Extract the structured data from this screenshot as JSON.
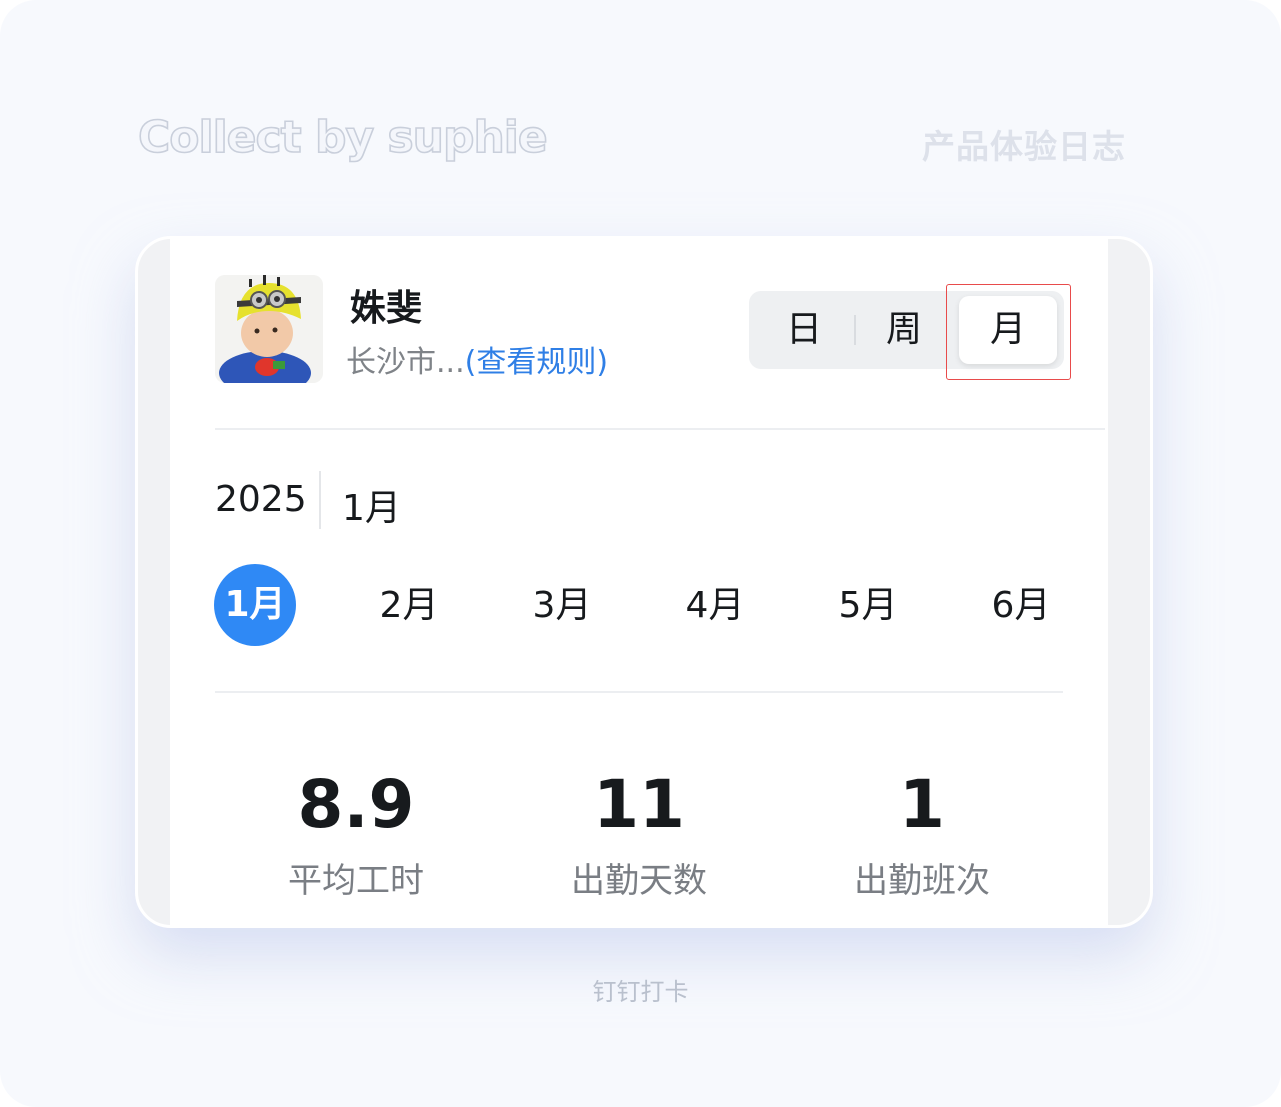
{
  "watermark": {
    "left": "Collect by suphie",
    "right": "产品体验日志"
  },
  "caption": "钉钉打卡",
  "profile": {
    "name": "姝斐",
    "location": "长沙市...",
    "rule_link": "(查看规则)"
  },
  "view_switch": {
    "day": "日",
    "week": "周",
    "month": "月",
    "selected": "月"
  },
  "period": {
    "year": "2025",
    "month": "1月"
  },
  "months": [
    "1月",
    "2月",
    "3月",
    "4月",
    "5月",
    "6月"
  ],
  "selected_month": "1月",
  "stats": [
    {
      "value": "8.9",
      "label": "平均工时"
    },
    {
      "value": "11",
      "label": "出勤天数"
    },
    {
      "value": "1",
      "label": "出勤班次"
    }
  ],
  "colors": {
    "accent": "#2f89f5",
    "link": "#2f7fe6",
    "highlight_border": "#e84b4b"
  }
}
